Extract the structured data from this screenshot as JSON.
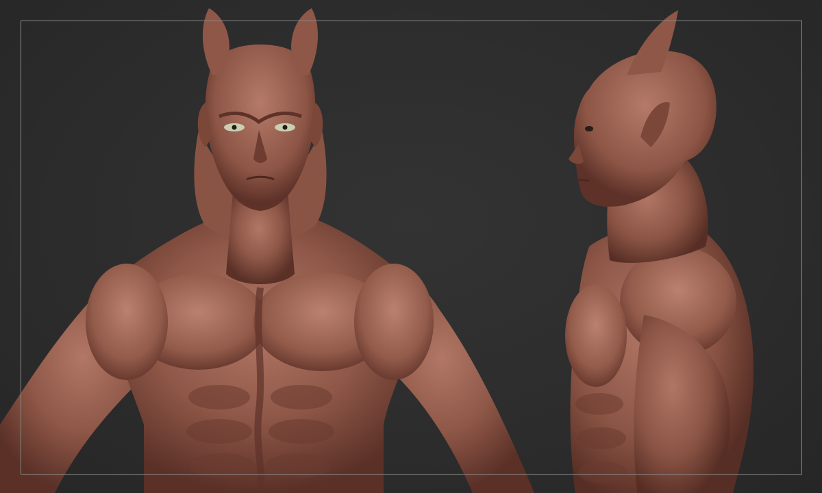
{
  "viewport": {
    "background": "#2b2b2b",
    "frame_color": "#8a8a8a"
  },
  "model": {
    "clay_color": "#8e5747",
    "clay_highlight": "#b27766",
    "clay_shadow": "#5a3027",
    "eye_color": "#c9cfb2",
    "views": [
      "front-view",
      "side-view"
    ]
  }
}
